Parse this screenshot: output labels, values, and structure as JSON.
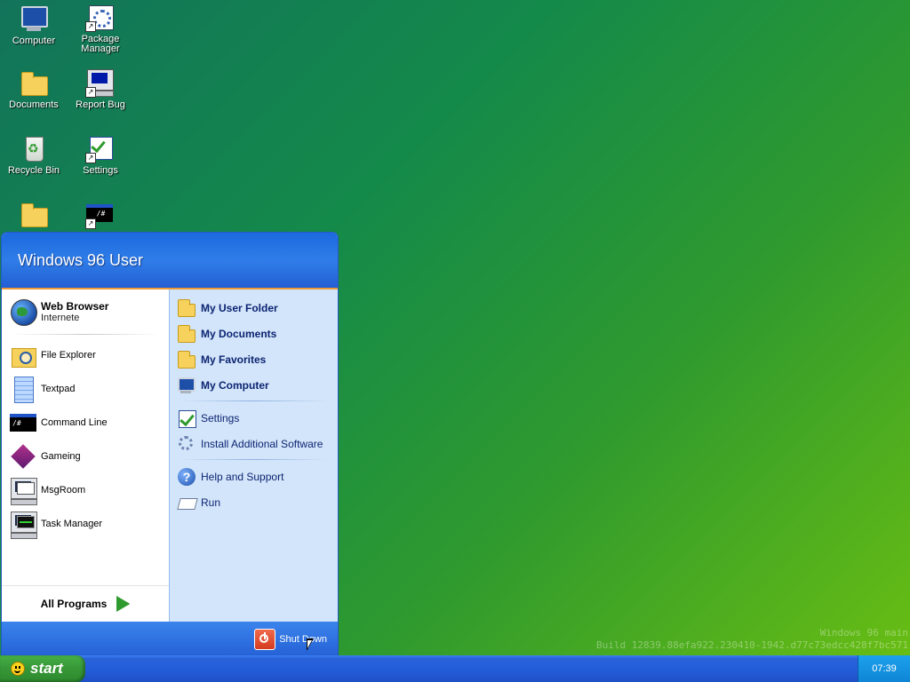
{
  "desktop": {
    "icons": [
      {
        "label": "Computer",
        "icon": "computer-icon"
      },
      {
        "label": "Package\nManager",
        "icon": "package-manager-icon"
      },
      {
        "label": "Documents",
        "icon": "documents-folder-icon"
      },
      {
        "label": "Report Bug",
        "icon": "report-bug-icon"
      },
      {
        "label": "Recycle Bin",
        "icon": "recycle-bin-icon"
      },
      {
        "label": "Settings",
        "icon": "settings-icon"
      },
      {
        "label": "",
        "icon": "folder-icon"
      },
      {
        "label": "",
        "icon": "terminal-icon"
      }
    ]
  },
  "start_menu": {
    "user_name": "Windows 96 User",
    "pinned": {
      "title": "Web Browser",
      "subtitle": "Internete"
    },
    "left_items": [
      "File Explorer",
      "Textpad",
      "Command Line",
      "Gameing",
      "MsgRoom",
      "Task Manager"
    ],
    "all_programs": "All Programs",
    "right_places": [
      "My User Folder",
      "My Documents",
      "My Favorites",
      "My Computer"
    ],
    "right_system": [
      "Settings",
      "Install Additional Software"
    ],
    "right_help": [
      "Help and Support",
      "Run"
    ],
    "shutdown": "Shut Down"
  },
  "taskbar": {
    "start_label": "start",
    "clock": "07:39"
  },
  "watermark": {
    "line1": "Windows 96 main",
    "line2": "Build 12839.88efa922.230410-1942.d77c73edcc428f7bc571"
  }
}
